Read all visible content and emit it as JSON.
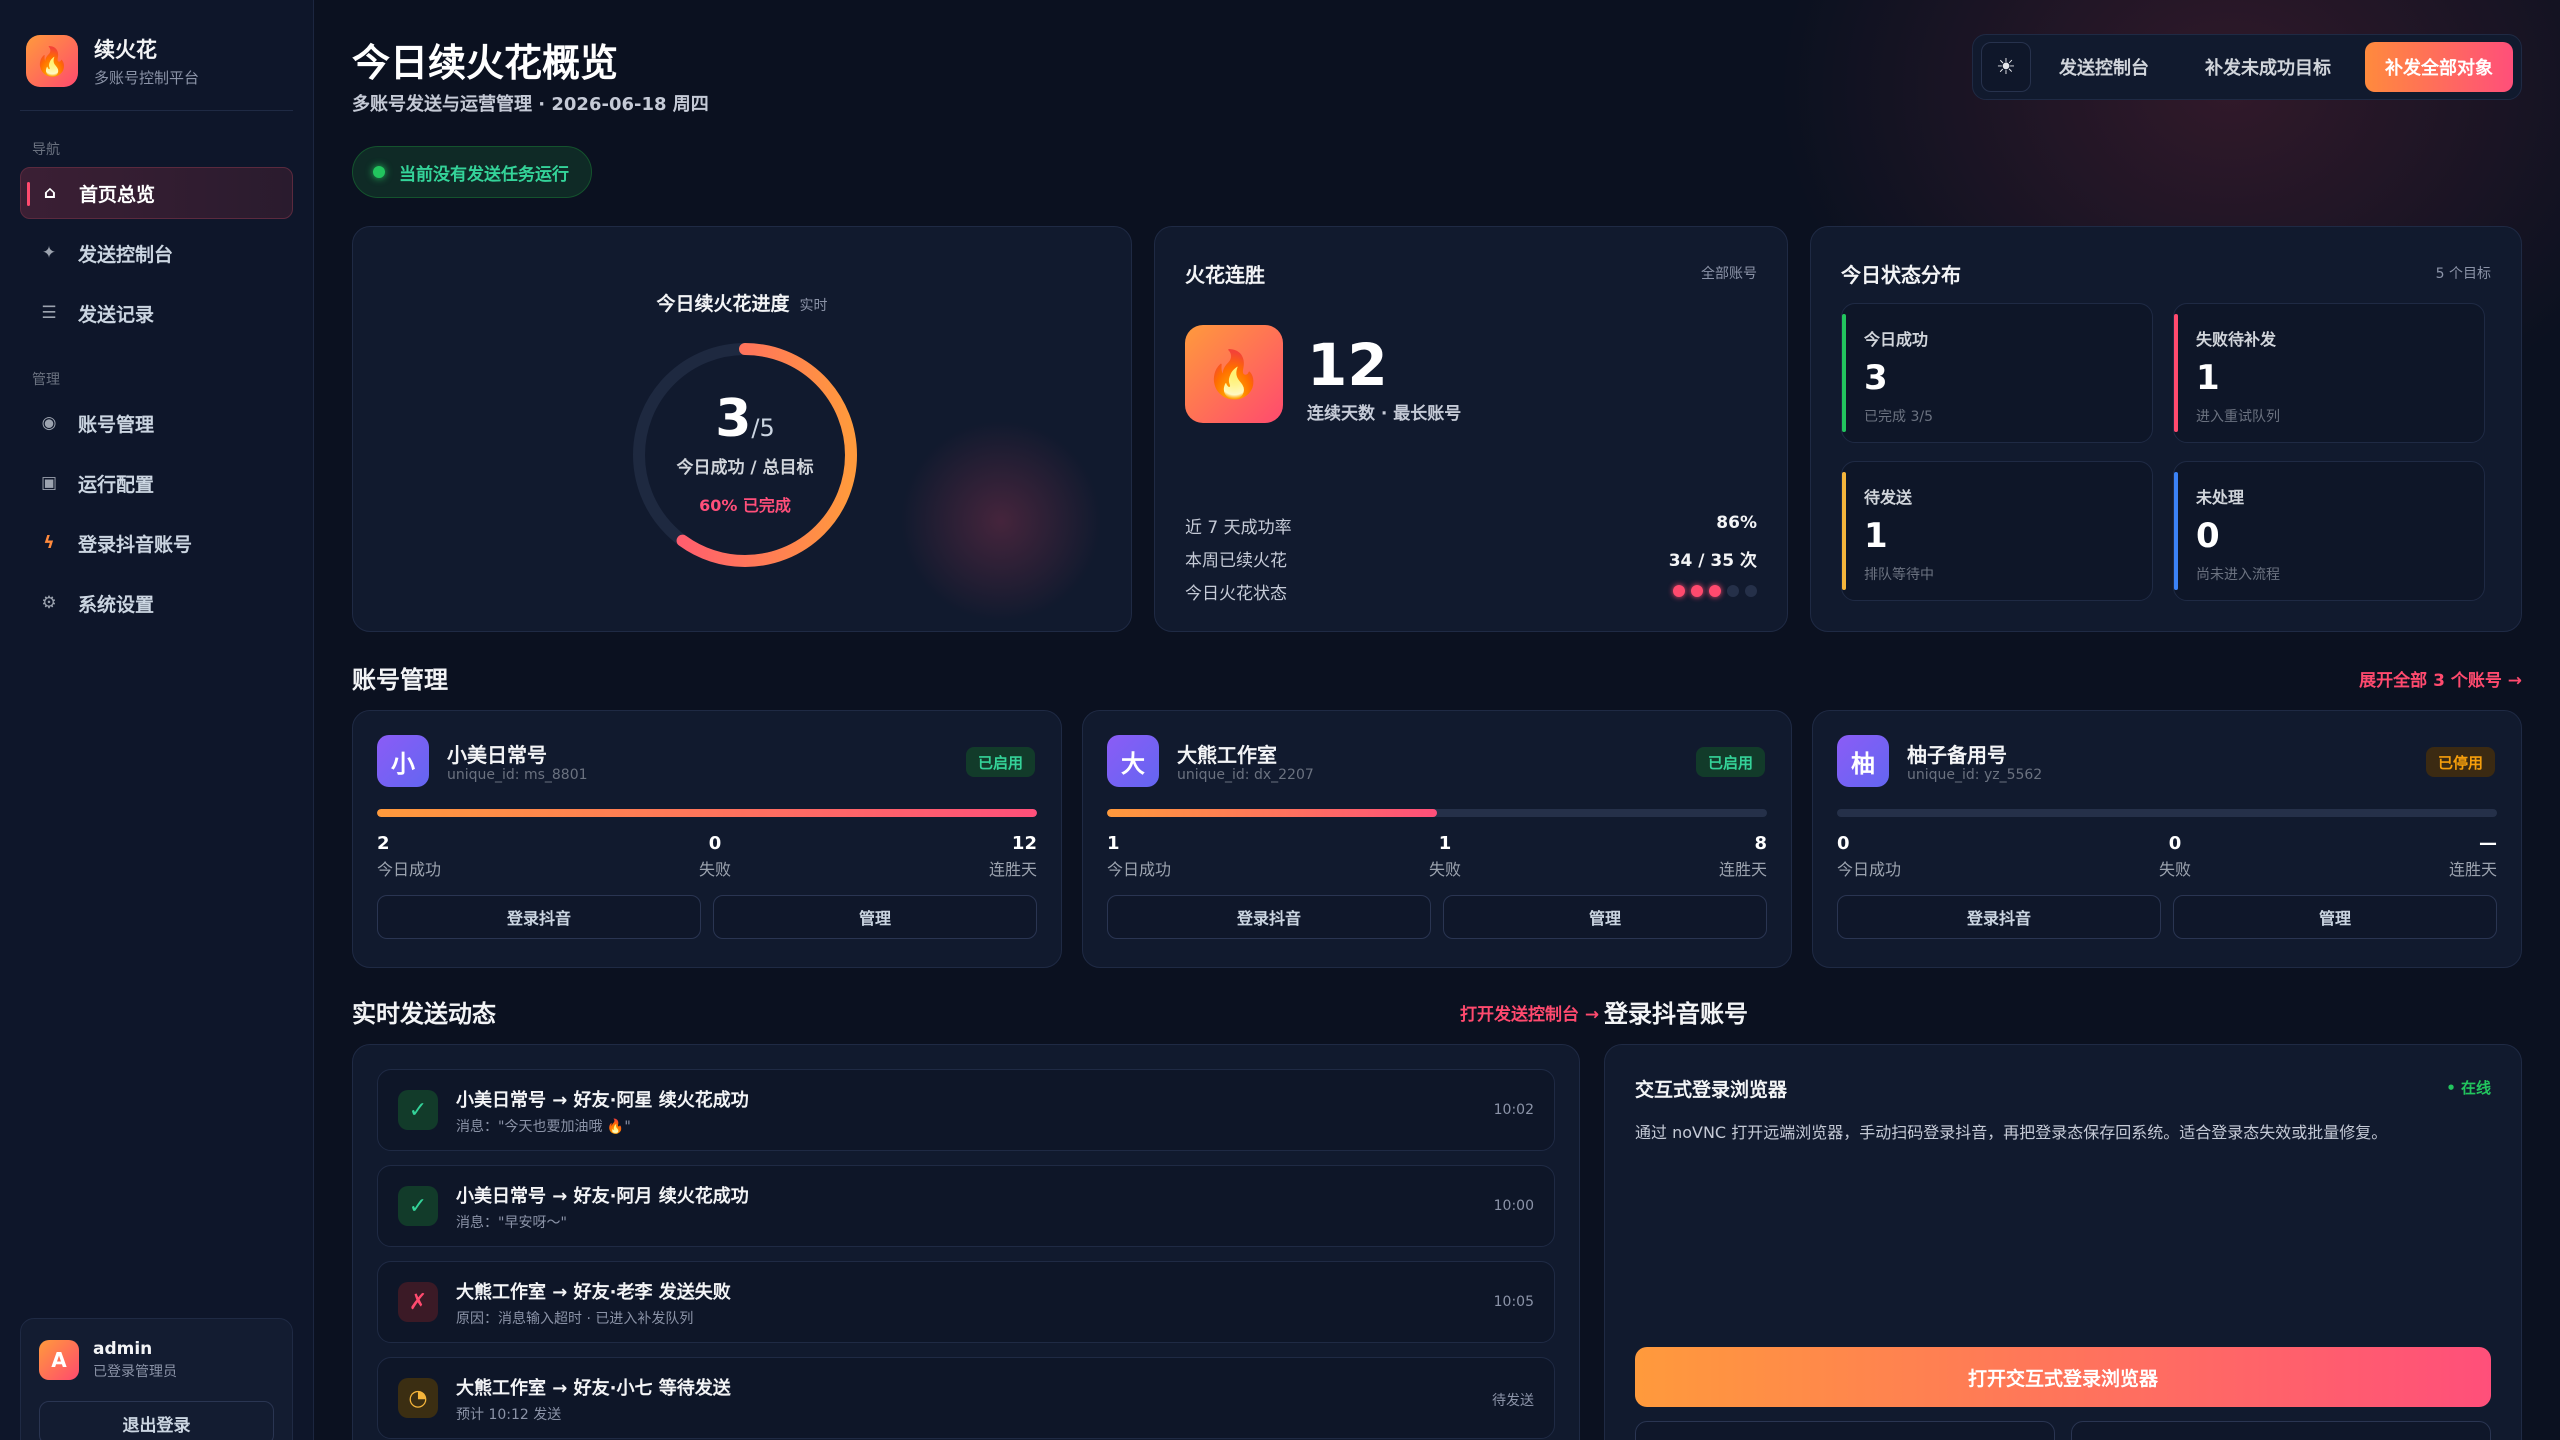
{
  "brand": {
    "name": "续火花",
    "subtitle": "多账号控制平台"
  },
  "sidebar": {
    "section_nav": "导航",
    "section_manage": "管理",
    "nav_items": [
      {
        "label": "首页总览",
        "icon": "home-icon",
        "active": true
      },
      {
        "label": "发送控制台",
        "icon": "sparkle-icon"
      },
      {
        "label": "发送记录",
        "icon": "list-icon"
      }
    ],
    "manage_items": [
      {
        "label": "账号管理",
        "icon": "user-dot-icon"
      },
      {
        "label": "运行配置",
        "icon": "config-icon"
      },
      {
        "label": "登录抖音账号",
        "icon": "bolt-icon"
      },
      {
        "label": "系统设置",
        "icon": "gear-icon"
      }
    ],
    "user": {
      "avatar": "A",
      "name": "admin",
      "role": "已登录管理员",
      "logout": "退出登录"
    }
  },
  "header": {
    "title": "今日续火花概览",
    "subtitle": "多账号发送与运营管理 · 2026-06-18 周四",
    "theme_icon": "☀",
    "btn_console": "发送控制台",
    "btn_retry_failed": "补发未成功目标",
    "btn_retry_all": "补发全部对象"
  },
  "status_pill": "当前没有发送任务运行",
  "progress": {
    "title": "今日续火花进度",
    "tag": "实时",
    "done": "3",
    "total": "/5",
    "label": "今日成功 / 总目标",
    "percent": "60%",
    "percent_suffix": " 已完成",
    "fraction": 0.6
  },
  "streak": {
    "title": "火花连胜",
    "scope": "全部账号",
    "days": "12",
    "label": "连续天数 · 最长账号",
    "rows": [
      {
        "label": "近 7 天成功率",
        "value": "86%"
      },
      {
        "label": "本周已续火花",
        "value": "34 / 35 次"
      },
      {
        "label": "今日火花状态",
        "value": ""
      }
    ],
    "flame_dots_on": 3,
    "flame_dots_total": 5
  },
  "distribution": {
    "title": "今日状态分布",
    "count": "5 个目标",
    "items": [
      {
        "label": "今日成功",
        "value": "3",
        "sub": "已完成 3/5",
        "color": "#22c55e"
      },
      {
        "label": "失败待补发",
        "value": "1",
        "sub": "进入重试队列",
        "color": "#ff4a6e"
      },
      {
        "label": "待发送",
        "value": "1",
        "sub": "排队等待中",
        "color": "#f5b53b"
      },
      {
        "label": "未处理",
        "value": "0",
        "sub": "尚未进入流程",
        "color": "#3b82f6"
      }
    ]
  },
  "accounts": {
    "title": "账号管理",
    "expand_link": "展开全部 3 个账号 →",
    "list": [
      {
        "avatar": "小",
        "avatar_color": "#6366f1",
        "name": "小美日常号",
        "uid": "unique_id: ms_8801",
        "status": "已启用",
        "enabled": true,
        "progress": 1.0,
        "success": "2",
        "success_label": "今日成功",
        "fail": "0",
        "fail_label": "失败",
        "streak": "12",
        "streak_label": "连胜天",
        "btn_login": "登录抖音",
        "btn_manage": "管理"
      },
      {
        "avatar": "大",
        "avatar_color": "#6366f1",
        "name": "大熊工作室",
        "uid": "unique_id: dx_2207",
        "status": "已启用",
        "enabled": true,
        "progress": 0.5,
        "success": "1",
        "success_label": "今日成功",
        "fail": "1",
        "fail_label": "失败",
        "streak": "8",
        "streak_label": "连胜天",
        "btn_login": "登录抖音",
        "btn_manage": "管理"
      },
      {
        "avatar": "柚",
        "avatar_color": "#6366f1",
        "name": "柚子备用号",
        "uid": "unique_id: yz_5562",
        "status": "已停用",
        "enabled": false,
        "progress": 0.0,
        "success": "0",
        "success_label": "今日成功",
        "fail": "0",
        "fail_label": "失败",
        "streak": "—",
        "streak_label": "连胜天",
        "btn_login": "登录抖音",
        "btn_manage": "管理"
      }
    ]
  },
  "activity": {
    "title": "实时发送动态",
    "link": "打开发送控制台 →",
    "items": [
      {
        "type": "ok",
        "icon": "✓",
        "title": "小美日常号 → 好友·阿星 续火花成功",
        "sub": "消息：\"今天也要加油哦 🔥\"",
        "time": "10:02"
      },
      {
        "type": "ok",
        "icon": "✓",
        "title": "小美日常号 → 好友·阿月 续火花成功",
        "sub": "消息：\"早安呀～\"",
        "time": "10:00"
      },
      {
        "type": "fail",
        "icon": "✗",
        "title": "大熊工作室 → 好友·老李 发送失败",
        "sub": "原因：消息输入超时 · 已进入补发队列",
        "time": "10:05"
      },
      {
        "type": "wait",
        "icon": "◔",
        "title": "大熊工作室 → 好友·小七 等待发送",
        "sub": "预计 10:12 发送",
        "time": "待发送"
      }
    ]
  },
  "login": {
    "section_title": "登录抖音账号",
    "card_title": "交互式登录浏览器",
    "online": "• 在线",
    "desc": "通过 noVNC 打开远端浏览器，手动扫码登录抖音，再把登录态保存回系统。适合登录态失效或批量修复。",
    "btn_open": "打开交互式登录浏览器"
  }
}
